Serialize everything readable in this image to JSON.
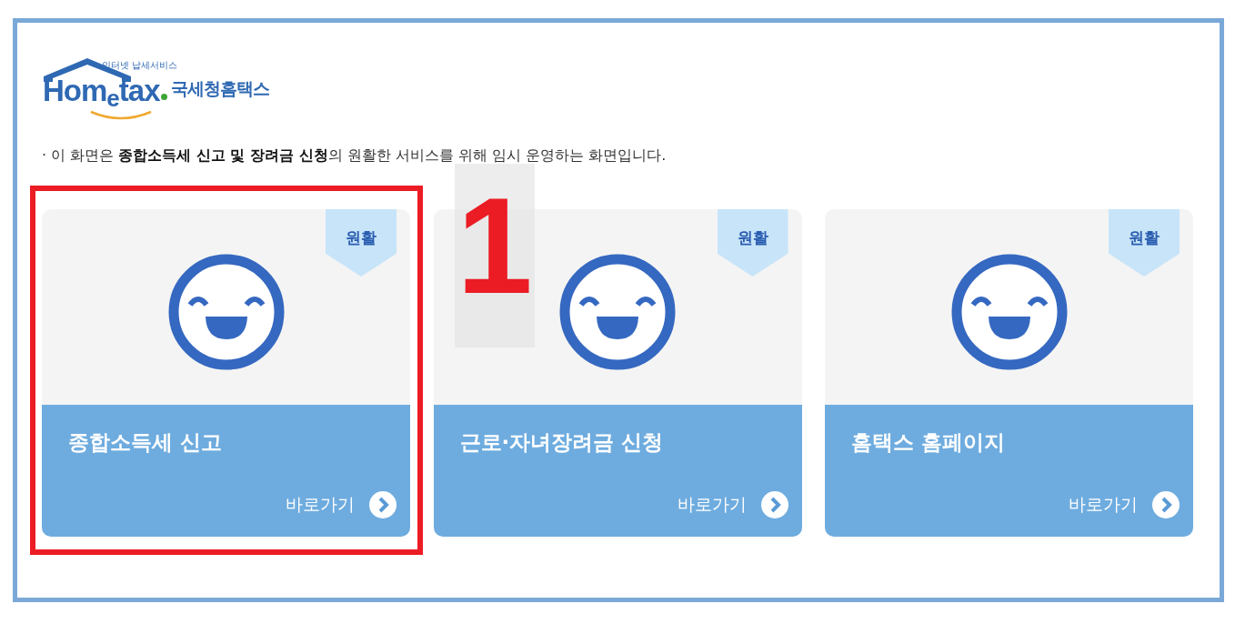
{
  "logo": {
    "tagline": "인터넷 납세서비스",
    "wordmark": "Hom$_{e}$tax",
    "name": "국세청홈택스"
  },
  "notice": "· 이 화면은 **종합소득세 신고 및 장려금 신청**의 원활한 서비스를 위해 임시 운영하는 화면입니다.",
  "cards": [
    {
      "badge": "원활",
      "title": "종합소득세 신고",
      "link": "바로가기",
      "highlighted": true
    },
    {
      "badge": "원활",
      "title": "근로·자녀장려금 신청",
      "link": "바로가기",
      "highlighted": false
    },
    {
      "badge": "원활",
      "title": "홈택스 홈페이지",
      "link": "바로가기",
      "highlighted": false
    }
  ],
  "annotation": {
    "label": "1"
  }
}
